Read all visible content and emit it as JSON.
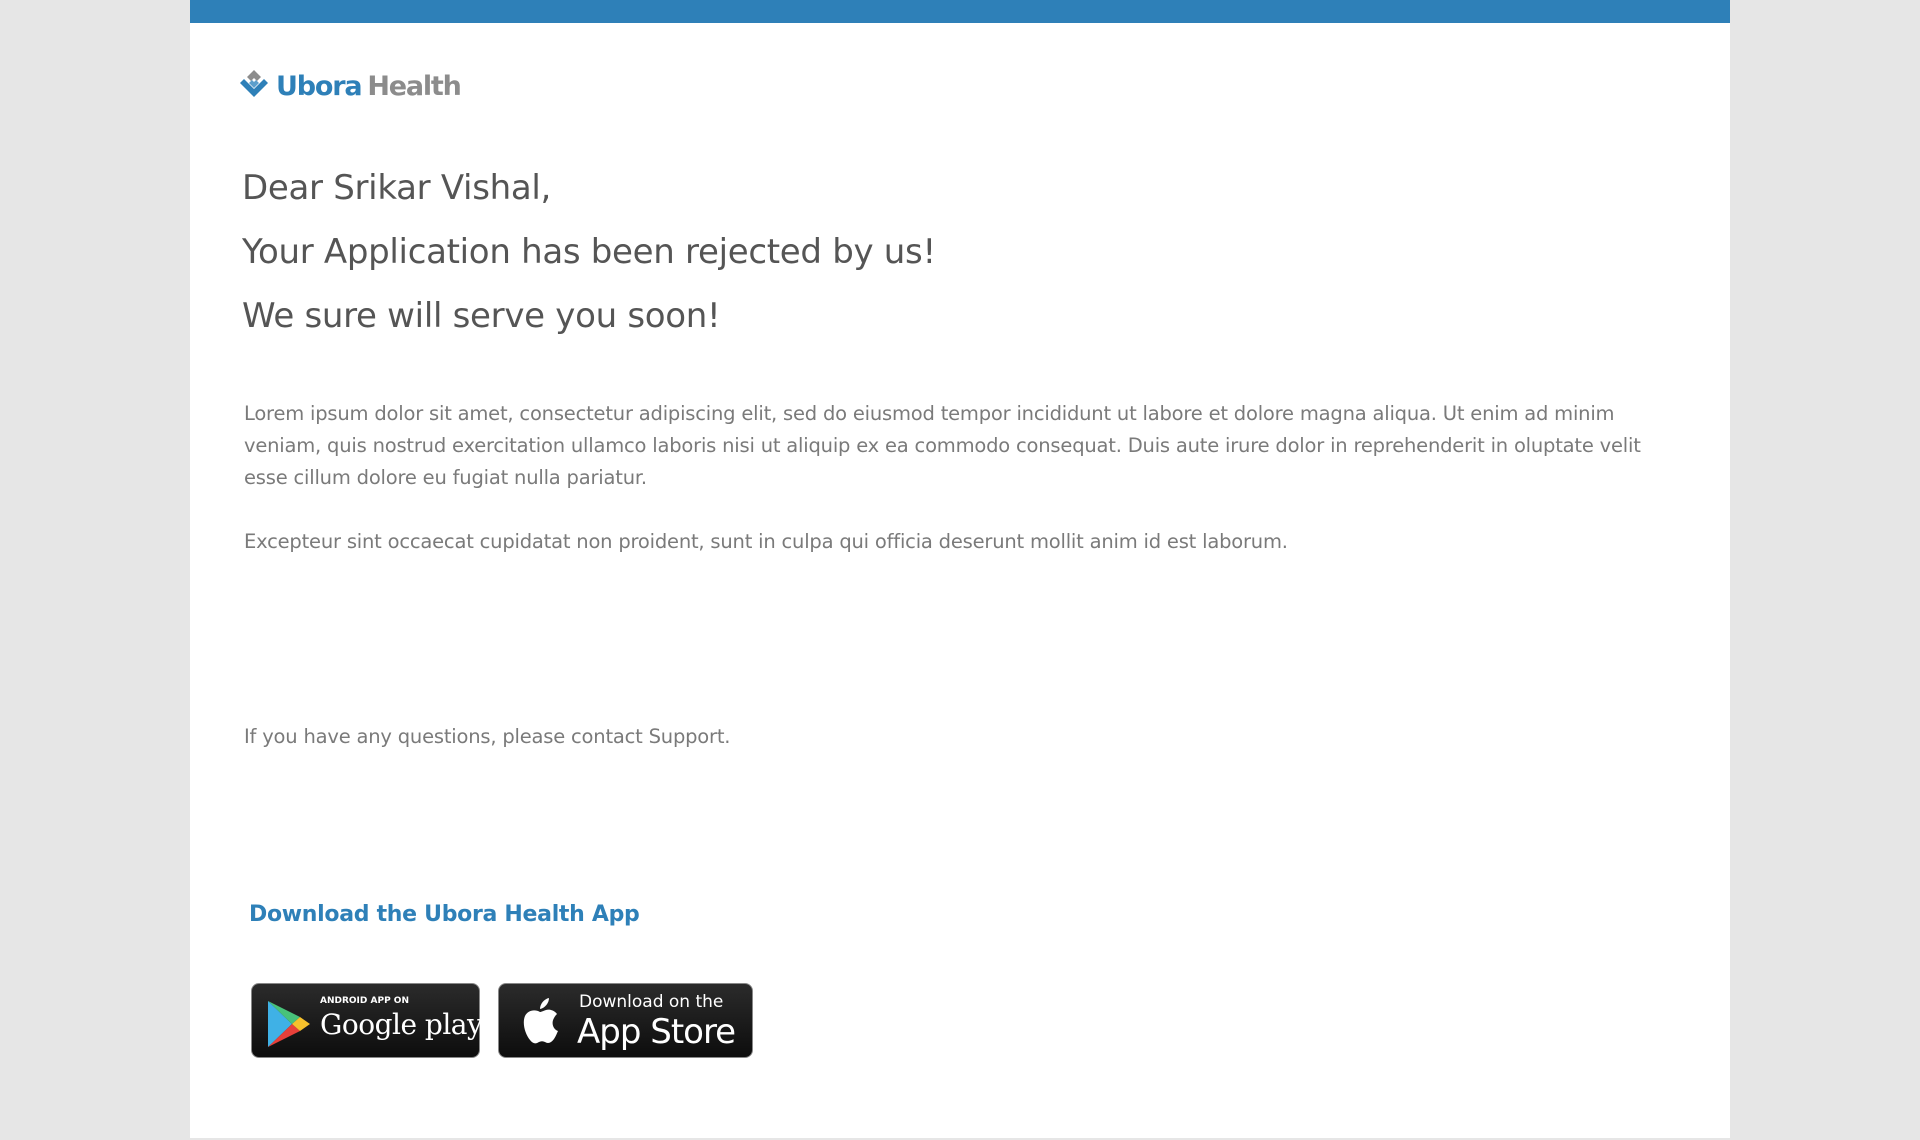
{
  "brand": {
    "name_part1": "Ubora",
    "name_part2": "Health",
    "logo_icon": "ubora-logo-icon",
    "primary_color": "#2e80b8",
    "secondary_color": "#8c8c8c"
  },
  "greeting": {
    "line1": "Dear Srikar Vishal,",
    "line2": "Your Application has been rejected by us!",
    "line3": "We sure will serve you soon!"
  },
  "body": {
    "paragraph1": "Lorem ipsum dolor sit amet, consectetur adipiscing elit, sed do eiusmod tempor incididunt ut labore et dolore magna aliqua. Ut enim ad minim veniam, quis nostrud exercitation ullamco laboris nisi ut aliquip ex ea commodo consequat. Duis aute irure dolor in reprehenderit in oluptate velit esse cillum dolore eu fugiat nulla pariatur.",
    "paragraph2": "Excepteur sint occaecat cupidatat non proident, sunt in culpa qui officia deserunt mollit anim id est laborum.",
    "support_note": "If you have any questions, please contact Support."
  },
  "app_download": {
    "heading": "Download the Ubora Health App",
    "google_play": {
      "small_label": "ANDROID APP ON",
      "big_label": "Google play",
      "icon": "google-play-icon"
    },
    "app_store": {
      "small_label": "Download on the",
      "big_label": "App Store",
      "icon": "apple-icon"
    }
  }
}
